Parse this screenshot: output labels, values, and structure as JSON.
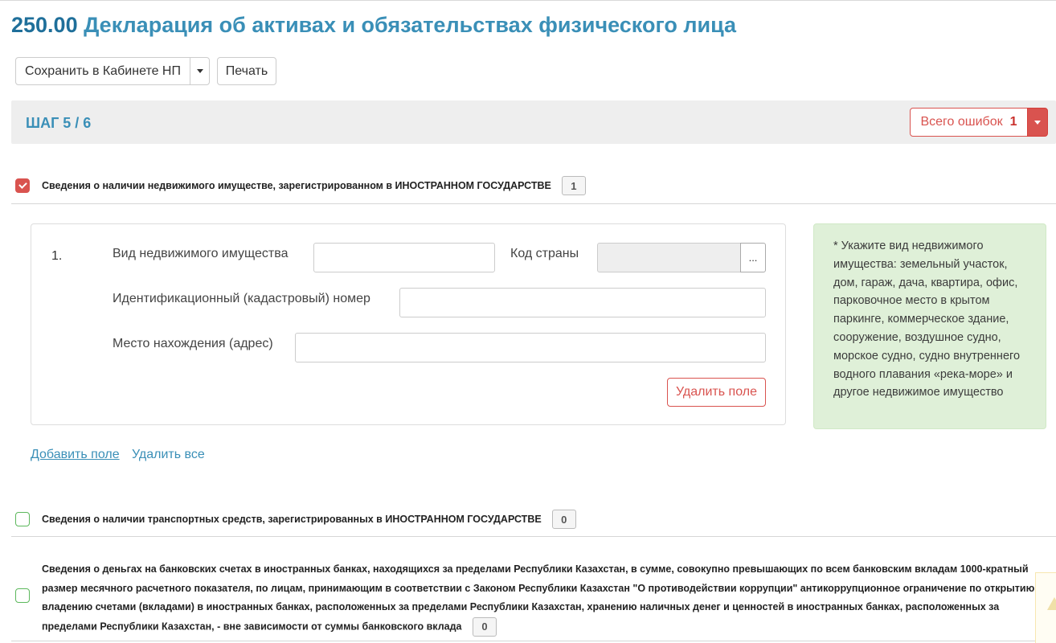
{
  "header": {
    "form_code": "250.00",
    "form_title": "Декларация об активах и обязательствах физического лица"
  },
  "toolbar": {
    "save_label": "Сохранить в Кабинете НП",
    "print_label": "Печать"
  },
  "step": {
    "label": "ШАГ 5 / 6",
    "errors_label": "Всего ошибок",
    "errors_count": "1"
  },
  "section_real_estate": {
    "title": "Сведения о наличии недвижимого имуществе, зарегистрированном в ИНОСТРАННОМ ГОСУДАРСТВЕ",
    "count": "1",
    "checked": true,
    "item": {
      "number": "1.",
      "property_type_label": "Вид недвижимого имущества",
      "property_type_value": "",
      "country_code_label": "Код страны",
      "country_code_value": "",
      "country_picker": "...",
      "cadastral_label": "Идентификационный (кадастровый) номер",
      "cadastral_value": "",
      "address_label": "Место нахождения (адрес)",
      "address_value": "",
      "delete_field_label": "Удалить поле"
    },
    "hint": "* Укажите вид недвижимого имущества: земельный участок, дом, гараж, дача, квартира, офис, парковочное место в крытом паркинге, коммерческое здание, сооружение, воздушное судно, морское судно, судно внутреннего водного плавания «река-море» и другое недвижимое имущество",
    "add_field_label": "Добавить поле",
    "delete_all_label": "Удалить все"
  },
  "section_vehicles": {
    "title": "Сведения о наличии транспортных средств, зарегистрированных в ИНОСТРАННОМ ГОСУДАРСТВЕ",
    "count": "0",
    "checked": false
  },
  "section_bank_accounts": {
    "title": "Сведения о деньгах на банковских счетах в иностранных банках, находящихся за пределами Республики Казахстан, в сумме, совокупно превышающих по всем банковским вкладам 1000-кратный размер месячного расчетного показателя, по лицам, принимающим в соответствии с Законом Республики Казахстан \"О противодействии коррупции\" антикоррупционное ограничение по открытию и владению счетами (вкладами) в иностранных банках, расположенных за пределами Республики Казахстан, хранению наличных денег и ценностей в иностранных банках, расположенных за пределами Республики Казахстан, - вне зависимости от суммы банковского вклада",
    "count": "0",
    "checked": false
  },
  "colors": {
    "accent": "#3a8fb7",
    "error": "#d9534f",
    "success_border": "#5cb85c",
    "hint_bg": "#dff0d8"
  }
}
